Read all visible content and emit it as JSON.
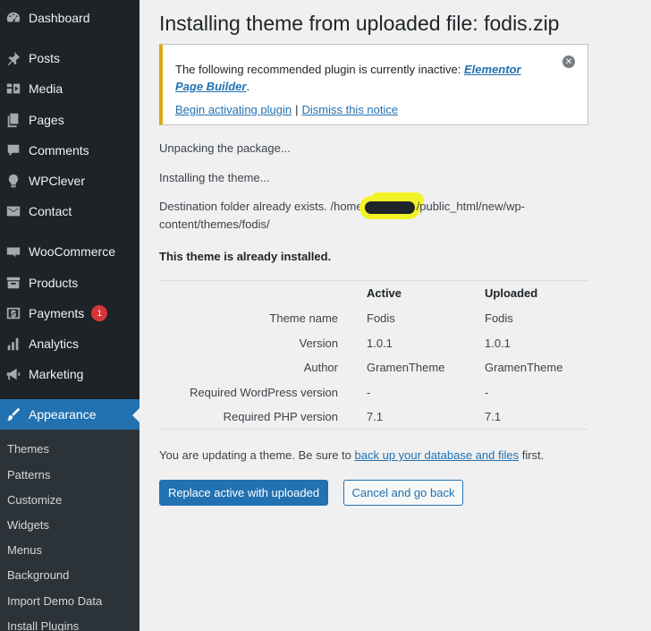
{
  "sidebar": {
    "items": [
      {
        "label": "Dashboard",
        "icon": "dashboard-icon"
      },
      {
        "label": "Posts",
        "icon": "pin-icon"
      },
      {
        "label": "Media",
        "icon": "media-icon"
      },
      {
        "label": "Pages",
        "icon": "pages-icon"
      },
      {
        "label": "Comments",
        "icon": "comment-icon"
      },
      {
        "label": "WPClever",
        "icon": "bulb-icon"
      },
      {
        "label": "Contact",
        "icon": "mail-icon"
      },
      {
        "label": "WooCommerce",
        "icon": "woo-icon"
      },
      {
        "label": "Products",
        "icon": "archive-icon"
      },
      {
        "label": "Payments",
        "icon": "dollar-icon",
        "badge": "1"
      },
      {
        "label": "Analytics",
        "icon": "bar-chart-icon"
      },
      {
        "label": "Marketing",
        "icon": "megaphone-icon"
      },
      {
        "label": "Appearance",
        "icon": "brush-icon"
      }
    ],
    "submenu": [
      "Themes",
      "Patterns",
      "Customize",
      "Widgets",
      "Menus",
      "Background",
      "Import Demo Data",
      "Install Plugins"
    ]
  },
  "main": {
    "title": "Installing theme from uploaded file: fodis.zip",
    "notice": {
      "text": "The following recommended plugin is currently inactive: ",
      "plugin_line1": "Elementor",
      "plugin_line2": "Page Builder",
      "period": ".",
      "activate": "Begin activating plugin",
      "separator": "|",
      "dismiss": "Dismiss this notice"
    },
    "messages": {
      "unpacking": "Unpacking the package...",
      "installing": "Installing the theme...",
      "dest_prefix": "Destination folder already exists. /home",
      "dest_suffix": "/public_html/new/wp-",
      "dest_line2": "content/themes/fodis/",
      "already": "This theme is already installed."
    },
    "table": {
      "headers": [
        "",
        "Active",
        "Uploaded"
      ],
      "rows": [
        [
          "Theme name",
          "Fodis",
          "Fodis"
        ],
        [
          "Version",
          "1.0.1",
          "1.0.1"
        ],
        [
          "Author",
          "GramenTheme",
          "GramenTheme"
        ],
        [
          "Required WordPress version",
          "-",
          "-"
        ],
        [
          "Required PHP version",
          "7.1",
          "7.1"
        ]
      ]
    },
    "update_note": {
      "prefix": "You are updating a theme. Be sure to ",
      "link": "back up your database and files",
      "suffix": " first."
    },
    "buttons": {
      "replace": "Replace active with uploaded",
      "cancel": "Cancel and go back"
    }
  },
  "colors": {
    "sidebar_bg": "#1d2327",
    "accent": "#2271b1",
    "notice_border": "#dba617",
    "badge": "#d63638"
  }
}
